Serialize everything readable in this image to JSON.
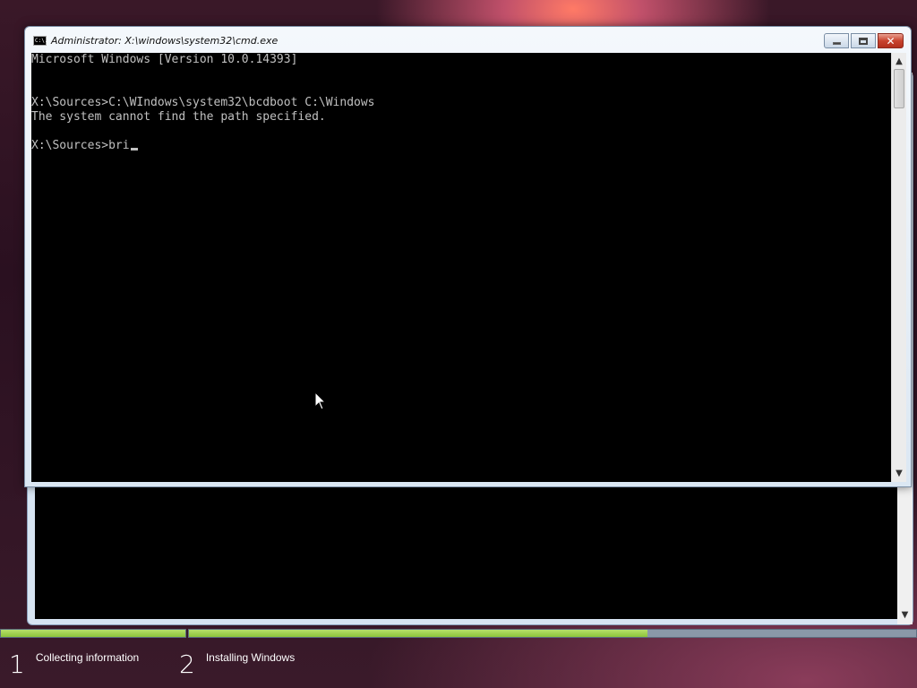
{
  "window": {
    "title": "Administrator: X:\\windows\\system32\\cmd.exe",
    "icon": "cmd-icon",
    "icon_text": "C:\\.",
    "buttons": {
      "minimize": "minimize-icon",
      "maximize": "maximize-icon",
      "close": "✕"
    }
  },
  "console": {
    "lines": [
      "Microsoft Windows [Version 10.0.14393]",
      "",
      "",
      "X:\\Sources>C:\\WIndows\\system32\\bcdboot C:\\Windows",
      "The system cannot find the path specified.",
      "",
      "X:\\Sources>bri"
    ],
    "text_color": "#c0c0c0",
    "background": "#000000"
  },
  "scrollbar": {
    "up": "▲",
    "down": "▼"
  },
  "setup_progress": {
    "steps": [
      {
        "number": "1",
        "label": "Collecting information",
        "progress": 1.0
      },
      {
        "number": "2",
        "label": "Installing Windows",
        "progress": 0.63
      }
    ],
    "accent": "#8cc43a"
  }
}
